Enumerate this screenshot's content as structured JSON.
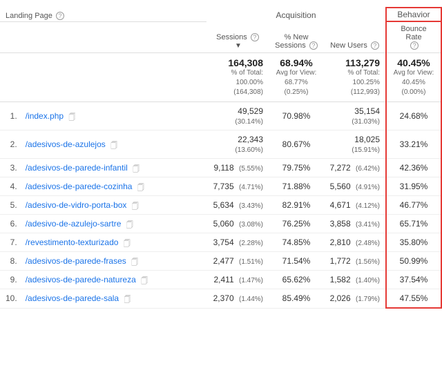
{
  "header": {
    "landing_page_label": "Landing Page",
    "help_icon_label": "?",
    "acquisition_label": "Acquisition",
    "behavior_label": "Behavior",
    "sessions_label": "Sessions",
    "new_sessions_label": "% New Sessions",
    "new_users_label": "New Users",
    "bounce_rate_label": "Bounce Rate"
  },
  "totals": {
    "sessions_main": "164,308",
    "sessions_sub1": "% of Total:",
    "sessions_sub2": "100.00%",
    "sessions_sub3": "(164,308)",
    "new_sessions_main": "68.94%",
    "new_sessions_sub1": "Avg for View:",
    "new_sessions_sub2": "68.77%",
    "new_sessions_sub3": "(0.25%)",
    "new_users_main": "113,279",
    "new_users_sub1": "% of Total:",
    "new_users_sub2": "100.25%",
    "new_users_sub3": "(112,993)",
    "bounce_rate_main": "40.45%",
    "bounce_rate_sub1": "Avg for View:",
    "bounce_rate_sub2": "40.45%",
    "bounce_rate_sub3": "(0.00%)"
  },
  "rows": [
    {
      "num": "1.",
      "page": "/index.php",
      "sessions": "49,529",
      "sessions_pct": "(30.14%)",
      "new_sessions": "70.98%",
      "new_users": "35,154",
      "new_users_pct": "(31.03%)",
      "bounce_rate": "24.68%"
    },
    {
      "num": "2.",
      "page": "/adesivos-de-azulejos",
      "sessions": "22,343",
      "sessions_pct": "(13.60%)",
      "new_sessions": "80.67%",
      "new_users": "18,025",
      "new_users_pct": "(15.91%)",
      "bounce_rate": "33.21%"
    },
    {
      "num": "3.",
      "page": "/adesivos-de-parede-infantil",
      "sessions": "9,118",
      "sessions_pct": "(5.55%)",
      "new_sessions": "79.75%",
      "new_users": "7,272",
      "new_users_pct": "(6.42%)",
      "bounce_rate": "42.36%"
    },
    {
      "num": "4.",
      "page": "/adesivos-de-parede-cozinha",
      "sessions": "7,735",
      "sessions_pct": "(4.71%)",
      "new_sessions": "71.88%",
      "new_users": "5,560",
      "new_users_pct": "(4.91%)",
      "bounce_rate": "31.95%"
    },
    {
      "num": "5.",
      "page": "/adesivo-de-vidro-porta-box",
      "sessions": "5,634",
      "sessions_pct": "(3.43%)",
      "new_sessions": "82.91%",
      "new_users": "4,671",
      "new_users_pct": "(4.12%)",
      "bounce_rate": "46.77%"
    },
    {
      "num": "6.",
      "page": "/adesivo-de-azulejo-sartre",
      "sessions": "5,060",
      "sessions_pct": "(3.08%)",
      "new_sessions": "76.25%",
      "new_users": "3,858",
      "new_users_pct": "(3.41%)",
      "bounce_rate": "65.71%"
    },
    {
      "num": "7.",
      "page": "/revestimento-texturizado",
      "sessions": "3,754",
      "sessions_pct": "(2.28%)",
      "new_sessions": "74.85%",
      "new_users": "2,810",
      "new_users_pct": "(2.48%)",
      "bounce_rate": "35.80%"
    },
    {
      "num": "8.",
      "page": "/adesivos-de-parede-frases",
      "sessions": "2,477",
      "sessions_pct": "(1.51%)",
      "new_sessions": "71.54%",
      "new_users": "1,772",
      "new_users_pct": "(1.56%)",
      "bounce_rate": "50.99%"
    },
    {
      "num": "9.",
      "page": "/adesivos-de-parede-natureza",
      "sessions": "2,411",
      "sessions_pct": "(1.47%)",
      "new_sessions": "65.62%",
      "new_users": "1,582",
      "new_users_pct": "(1.40%)",
      "bounce_rate": "37.54%"
    },
    {
      "num": "10.",
      "page": "/adesivos-de-parede-sala",
      "sessions": "2,370",
      "sessions_pct": "(1.44%)",
      "new_sessions": "85.49%",
      "new_users": "2,026",
      "new_users_pct": "(1.79%)",
      "bounce_rate": "47.55%"
    }
  ]
}
